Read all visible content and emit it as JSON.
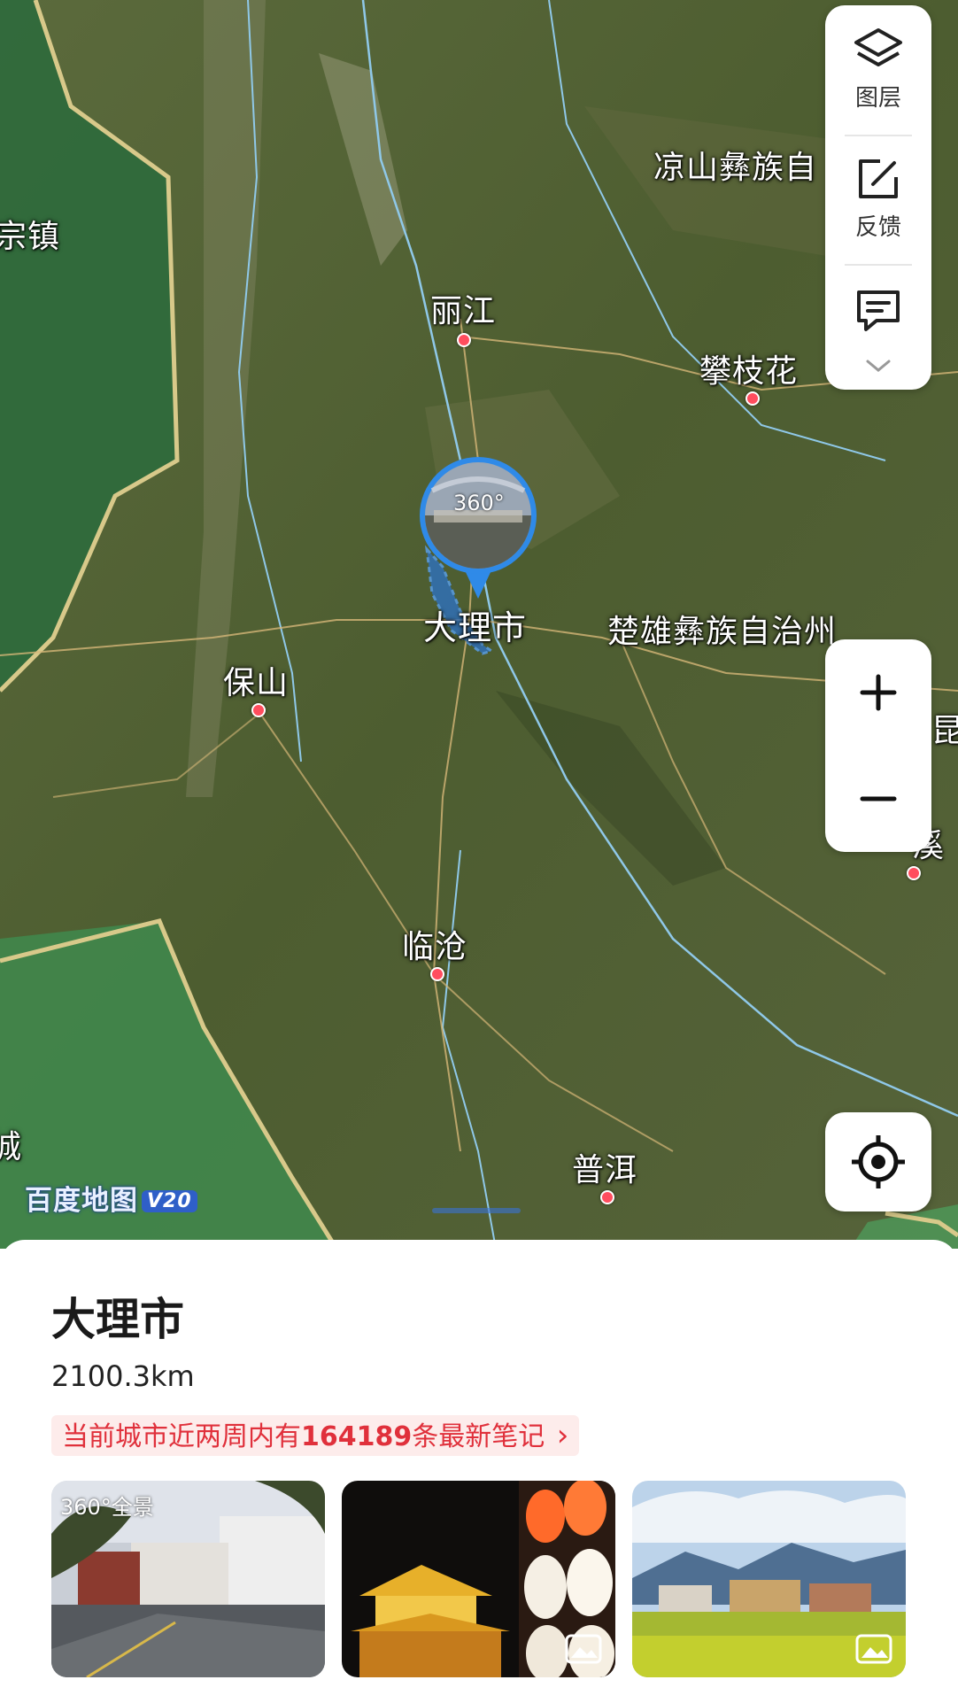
{
  "map": {
    "cities": [
      {
        "name": "丽江",
        "dot": true
      },
      {
        "name": "攀枝花",
        "dot": true
      },
      {
        "name": "保山",
        "dot": true
      },
      {
        "name": "临沧",
        "dot": true
      },
      {
        "name": "普洱",
        "dot": true
      },
      {
        "name": "大理市",
        "dot": false
      }
    ],
    "regions": [
      {
        "name": "凉山彝族自"
      },
      {
        "name": "楚雄彝族自治州"
      },
      {
        "name": "宗镇"
      },
      {
        "name": "昆"
      },
      {
        "name": "溪"
      },
      {
        "name": "城"
      }
    ],
    "panorama_badge": "360°",
    "logo": {
      "text": "百度地图",
      "version": "V20"
    }
  },
  "controls": {
    "layers_label": "图层",
    "feedback_label": "反馈",
    "zoom_in": "+",
    "zoom_out": "−"
  },
  "sheet": {
    "place_name": "大理市",
    "distance": "2100.3km",
    "notes_prefix": "当前城市近两周内有",
    "notes_count": "164189",
    "notes_suffix": "条最新笔记",
    "notes_chevron": "›",
    "thumbnails": [
      {
        "badge": "360°全景",
        "icon": "panorama-icon"
      },
      {
        "icon": "image-icon"
      },
      {
        "icon": "image-icon"
      }
    ]
  },
  "colors": {
    "accent_red": "#e0303b",
    "city_dot": "#ff4d5e",
    "marker_blue": "#2f8ae8"
  }
}
